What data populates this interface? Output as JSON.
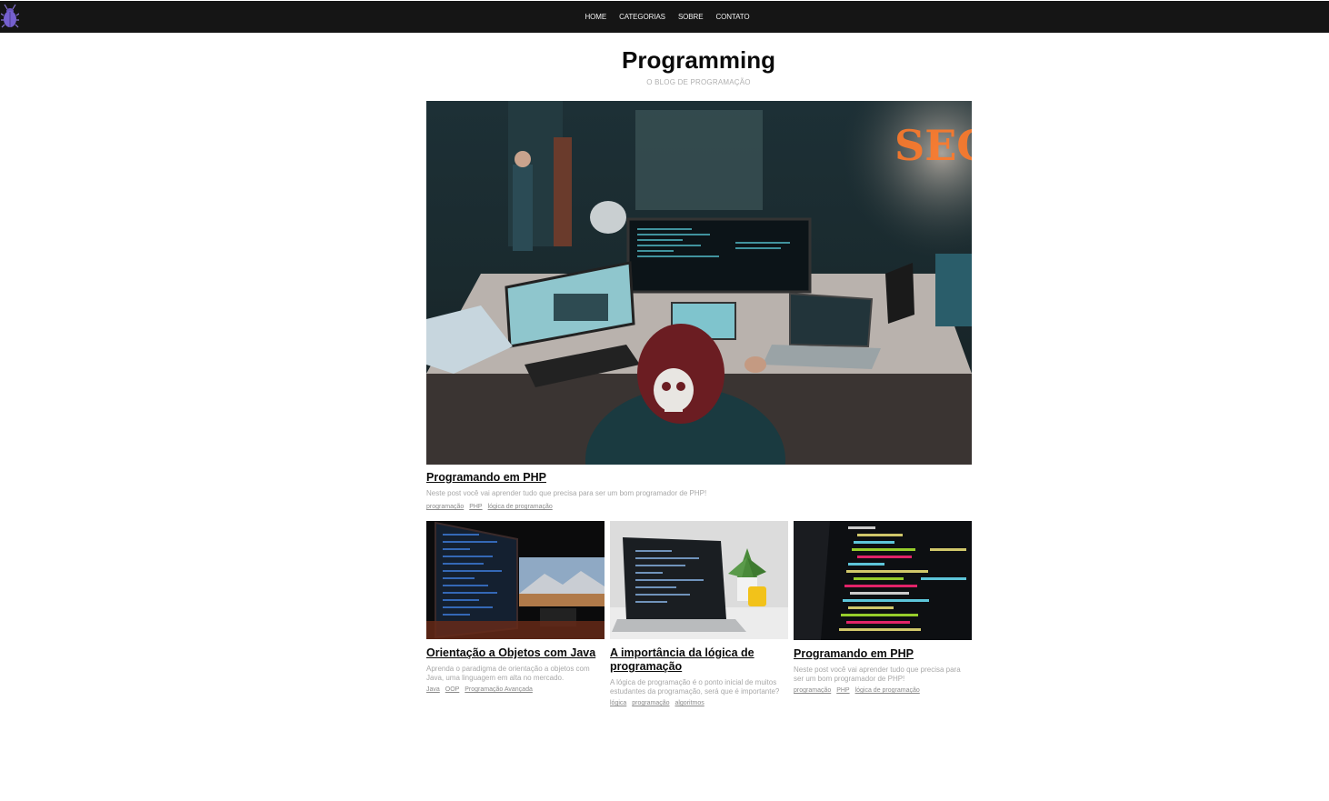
{
  "nav": {
    "logo_icon": "bug-icon",
    "items": [
      {
        "label": "HOME"
      },
      {
        "label": "CATEGORIAS"
      },
      {
        "label": "SOBRE"
      },
      {
        "label": "CONTATO"
      }
    ]
  },
  "header": {
    "title": "Programming",
    "subtitle": "O BLOG DE PROGRAMAÇÃO"
  },
  "featured": {
    "title": "Programando em PHP",
    "excerpt": "Neste post você vai aprender tudo que precisa para ser um bom programador de PHP!",
    "tags": [
      "programação",
      "PHP",
      "lógica de programação"
    ]
  },
  "posts": [
    {
      "title": "Orientação a Objetos com Java",
      "excerpt": "Aprenda o paradigma de orientação a objetos com Java, uma linguagem em alta no mercado.",
      "tags": [
        "Java",
        "OOP",
        "Programação Avançada"
      ]
    },
    {
      "title": "A importância da lógica de programação",
      "excerpt": "A lógica de programação é o ponto inicial de muitos estudantes da programação, será que é importante?",
      "tags": [
        "lógica",
        "programação",
        "algoritmos"
      ]
    },
    {
      "title": "Programando em PHP",
      "excerpt": "Neste post você vai aprender tudo que precisa para ser um bom programador de PHP!",
      "tags": [
        "programação",
        "PHP",
        "lógica de programação"
      ]
    }
  ],
  "colors": {
    "navbar": "#151515",
    "text": "#0b0b0b",
    "muted": "#a8a8a8"
  }
}
